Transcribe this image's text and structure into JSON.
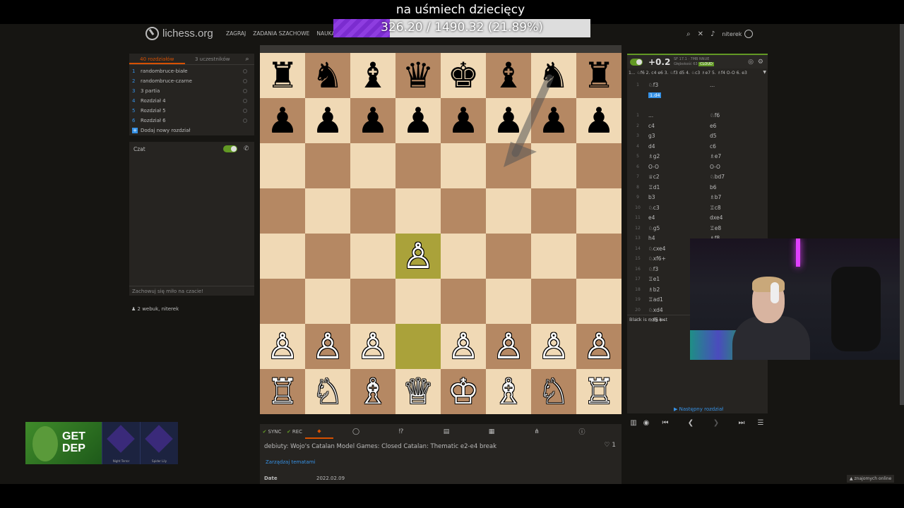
{
  "overlay": {
    "title": "na uśmiech dziecięcy",
    "progress_text": "326.20 / 1490.32 (21.89%)",
    "progress_fraction": 0.2189
  },
  "header": {
    "logo": "lichess.org",
    "nav": [
      "ZAGRAJ",
      "ZADANIA SZACHOWE",
      "NAUKA"
    ],
    "username": "niterek"
  },
  "chapters": {
    "tab_chapters": "40 rozdziałów",
    "tab_members": "3 uczestników",
    "items": [
      {
        "num": "1",
        "label": "randombruce-białe"
      },
      {
        "num": "2",
        "label": "randombruce-czarne"
      },
      {
        "num": "3",
        "label": "3 partia"
      },
      {
        "num": "4",
        "label": "Rozdział 4"
      },
      {
        "num": "5",
        "label": "Rozdział 5"
      },
      {
        "num": "6",
        "label": "Rozdział 6"
      }
    ],
    "add_label": "Dodaj nowy rozdział"
  },
  "chat": {
    "title": "Czat",
    "placeholder": "Zachowuj się miło na czacie!",
    "members": "2  webuk, niterek"
  },
  "board": {
    "ranks": [
      [
        "♜",
        "♞",
        "♝",
        "♛",
        "♚",
        "♝",
        "♞",
        "♜"
      ],
      [
        "♟",
        "♟",
        "♟",
        "♟",
        "♟",
        "♟",
        "♟",
        "♟"
      ],
      [
        "",
        "",
        "",
        "",
        "",
        "",
        "",
        ""
      ],
      [
        "",
        "",
        "",
        "",
        "",
        "",
        "",
        ""
      ],
      [
        "",
        "",
        "",
        "♙",
        "",
        "",
        "",
        ""
      ],
      [
        "",
        "",
        "",
        "",
        "",
        "",
        "",
        ""
      ],
      [
        "♙",
        "♙",
        "♙",
        "",
        "♙",
        "♙",
        "♙",
        "♙"
      ],
      [
        "♖",
        "♘",
        "♗",
        "♕",
        "♔",
        "♗",
        "♘",
        "♖"
      ]
    ],
    "colors": [
      [
        "b",
        "b",
        "b",
        "b",
        "b",
        "b",
        "b",
        "b"
      ],
      [
        "b",
        "b",
        "b",
        "b",
        "b",
        "b",
        "b",
        "b"
      ],
      [
        "",
        "",
        "",
        "",
        "",
        "",
        "",
        ""
      ],
      [
        "",
        "",
        "",
        "",
        "",
        "",
        "",
        ""
      ],
      [
        "",
        "",
        "",
        "w",
        "",
        "",
        "",
        ""
      ],
      [
        "",
        "",
        "",
        "",
        "",
        "",
        "",
        ""
      ],
      [
        "w",
        "w",
        "w",
        "",
        "w",
        "w",
        "w",
        "w"
      ],
      [
        "w",
        "w",
        "w",
        "w",
        "w",
        "w",
        "w",
        "w"
      ]
    ],
    "highlight": [
      [
        4,
        3
      ],
      [
        6,
        3
      ]
    ]
  },
  "tools": {
    "sync": "SYNC",
    "rec": "REC"
  },
  "study": {
    "title": "debiuty: Wojo's Catalan Model Games: Closed Catalan: Thematic e2-e4 break",
    "likes": "1",
    "manage_tags": "Zarządzaj tematami",
    "date_label": "Date",
    "date_value": "2022.02.09"
  },
  "analysis": {
    "score": "+0.2",
    "engine_line1": "SF 17.1 · 7MB NNUE",
    "engine_line2": "Głębokość 63",
    "cloud": "CLOUD",
    "pv": "1... ♘f6 2. c4 e6 3. ♘f3 d5 4. ♘c3 ♗e7 5. ♗f4 O-O 6. e3",
    "first_row": {
      "n": "1",
      "w": "♘f3",
      "b": "..."
    },
    "current": "1.d4",
    "moves": [
      {
        "n": "1",
        "w": "...",
        "b": "♘f6"
      },
      {
        "n": "2",
        "w": "c4",
        "b": "e6"
      },
      {
        "n": "3",
        "w": "g3",
        "b": "d5"
      },
      {
        "n": "4",
        "w": "d4",
        "b": "c6"
      },
      {
        "n": "5",
        "w": "♗g2",
        "b": "♗e7"
      },
      {
        "n": "6",
        "w": "O-O",
        "b": "O-O"
      },
      {
        "n": "7",
        "w": "♕c2",
        "b": "♘bd7"
      },
      {
        "n": "8",
        "w": "♖d1",
        "b": "b6"
      },
      {
        "n": "9",
        "w": "b3",
        "b": "♗b7"
      },
      {
        "n": "10",
        "w": "♘c3",
        "b": "♖c8"
      },
      {
        "n": "11",
        "w": "e4",
        "b": "dxe4"
      },
      {
        "n": "12",
        "w": "♘g5",
        "b": "♖e8"
      },
      {
        "n": "13",
        "w": "h4",
        "b": "♗f8"
      },
      {
        "n": "14",
        "w": "♘cxe4",
        "b": "h6"
      },
      {
        "n": "15",
        "w": "♘xf6+",
        "b": ""
      },
      {
        "n": "16",
        "w": "♘f3",
        "b": ""
      },
      {
        "n": "17",
        "w": "♖e1",
        "b": ""
      },
      {
        "n": "18",
        "w": "♗b2",
        "b": ""
      },
      {
        "n": "19",
        "w": "♖ad1",
        "b": ""
      },
      {
        "n": "20",
        "w": "♘xd4",
        "b": ""
      },
      {
        "n": "21",
        "w": "♘f5+-",
        "b": ""
      }
    ],
    "status": "Black is now lost",
    "next_chapter": "Następny rozdział"
  },
  "ad": {
    "text_line1": "GET",
    "text_line2": "DEP",
    "caption1": "Night Terror",
    "caption2": "Spider Lily"
  },
  "footer": {
    "friends": "znajomych online"
  }
}
